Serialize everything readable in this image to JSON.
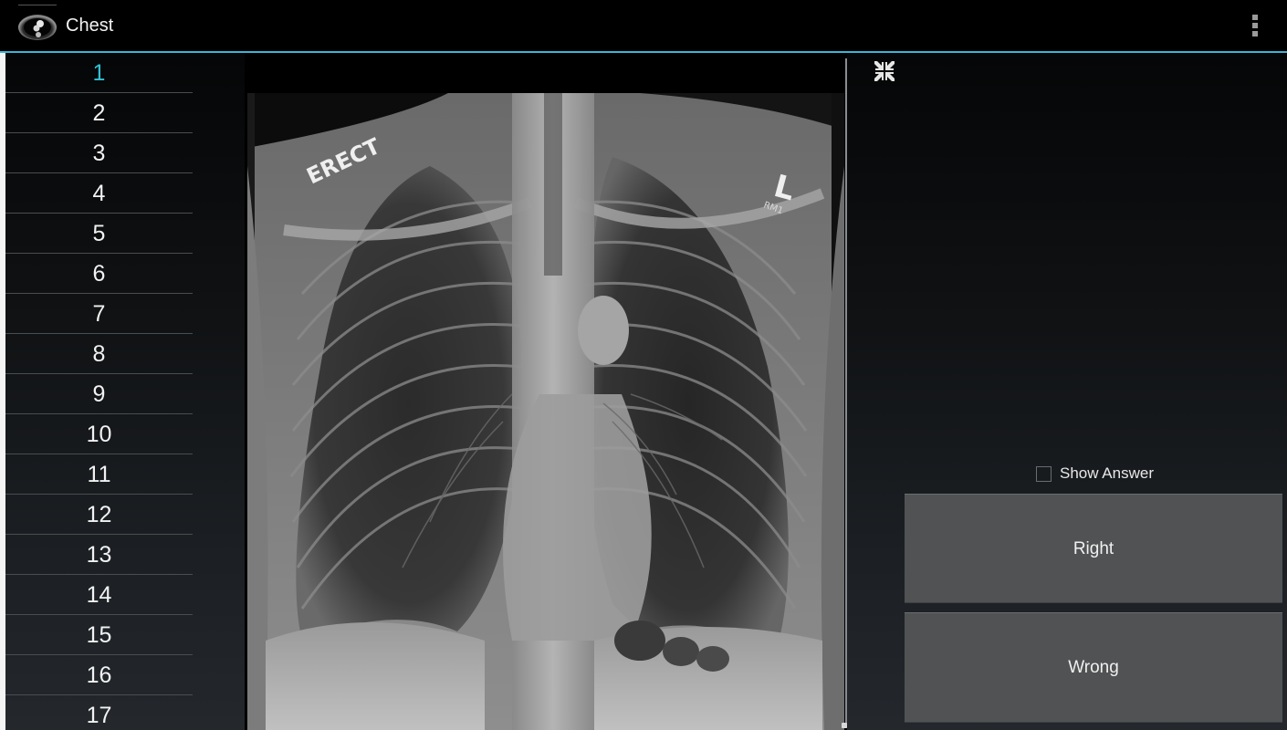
{
  "action_bar": {
    "title": "Chest",
    "app_icon": "ct-chest-scan-icon",
    "overflow_icon": "overflow-menu-icon",
    "accent_color": "#3fb4d6"
  },
  "question_list": {
    "active_index": 0,
    "active_color": "#33c0d4",
    "items": [
      "1",
      "2",
      "3",
      "4",
      "5",
      "6",
      "7",
      "8",
      "9",
      "10",
      "11",
      "12",
      "13",
      "14",
      "15",
      "16",
      "17"
    ]
  },
  "image_panel": {
    "image_description": "Chest X-ray (PA, erect)",
    "markers": {
      "erect": "ERECT",
      "side": "L",
      "tech": "RM1"
    },
    "collapse_icon": "collapse-fullscreen-icon"
  },
  "answer_panel": {
    "show_answer_label": "Show Answer",
    "show_answer_checked": false,
    "right_label": "Right",
    "wrong_label": "Wrong"
  }
}
